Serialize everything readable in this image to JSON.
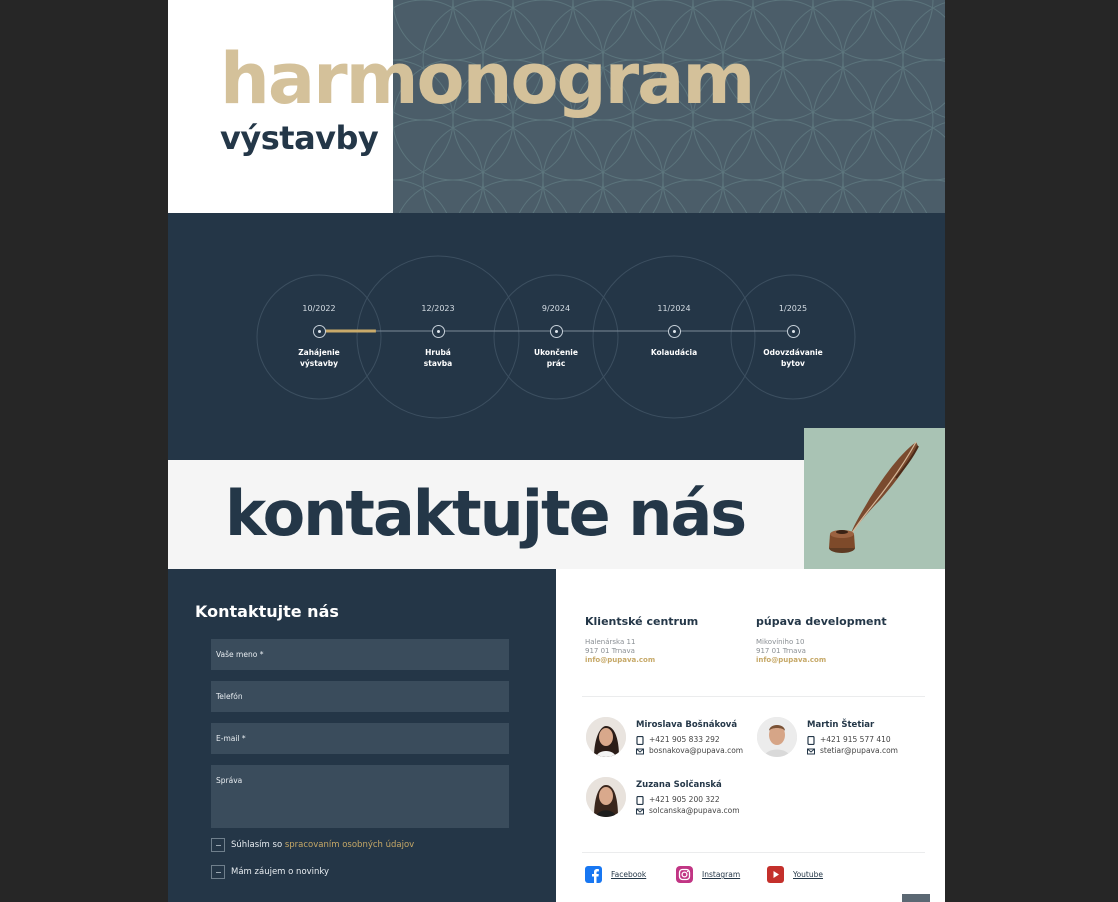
{
  "hero": {
    "title": "harmonogram",
    "subtitle": "výstavby"
  },
  "timeline": {
    "progress": 0.12,
    "steps": [
      {
        "date": "10/2022",
        "label_1": "Zahájenie",
        "label_2": "výstavby"
      },
      {
        "date": "12/2023",
        "label_1": "Hrubá",
        "label_2": "stavba"
      },
      {
        "date": "9/2024",
        "label_1": "Ukončenie",
        "label_2": "prác"
      },
      {
        "date": "11/2024",
        "label_1": "Kolaudácia",
        "label_2": ""
      },
      {
        "date": "1/2025",
        "label_1": "Odovzdávanie",
        "label_2": "bytov"
      }
    ]
  },
  "banner": {
    "title": "kontaktujte nás"
  },
  "form": {
    "title": "Kontaktujte nás",
    "fields": {
      "name": "Vaše meno *",
      "phone": "Telefón",
      "email": "E-mail *",
      "message": "Správa"
    },
    "consent_text": "Súhlasím so ",
    "consent_link": "spracovaním osobných údajov",
    "newsletter_text": "Mám záujem o novinky"
  },
  "offices": [
    {
      "title": "Klientské centrum",
      "line1": "Halenárska 11",
      "line2": "917 01 Trnava",
      "email": "info@pupava.com"
    },
    {
      "title": "púpava development",
      "line1": "Mikovíniho 10",
      "line2": "917 01 Trnava",
      "email": "info@pupava.com"
    }
  ],
  "people": [
    {
      "name": "Miroslava Bošnáková",
      "phone": "+421 905 833 292",
      "email": "bosnakova@pupava.com"
    },
    {
      "name": "Martin Štetiar",
      "phone": "+421 915 577 410",
      "email": "stetiar@pupava.com"
    },
    {
      "name": "Zuzana Solčanská",
      "phone": "+421 905 200 322",
      "email": "solcanska@pupava.com"
    }
  ],
  "social": {
    "facebook": "Facebook",
    "instagram": "Instagram",
    "youtube": "Youtube"
  },
  "colors": {
    "navy": "#243647",
    "gold": "#d4c19a",
    "accent": "#c6a867"
  }
}
